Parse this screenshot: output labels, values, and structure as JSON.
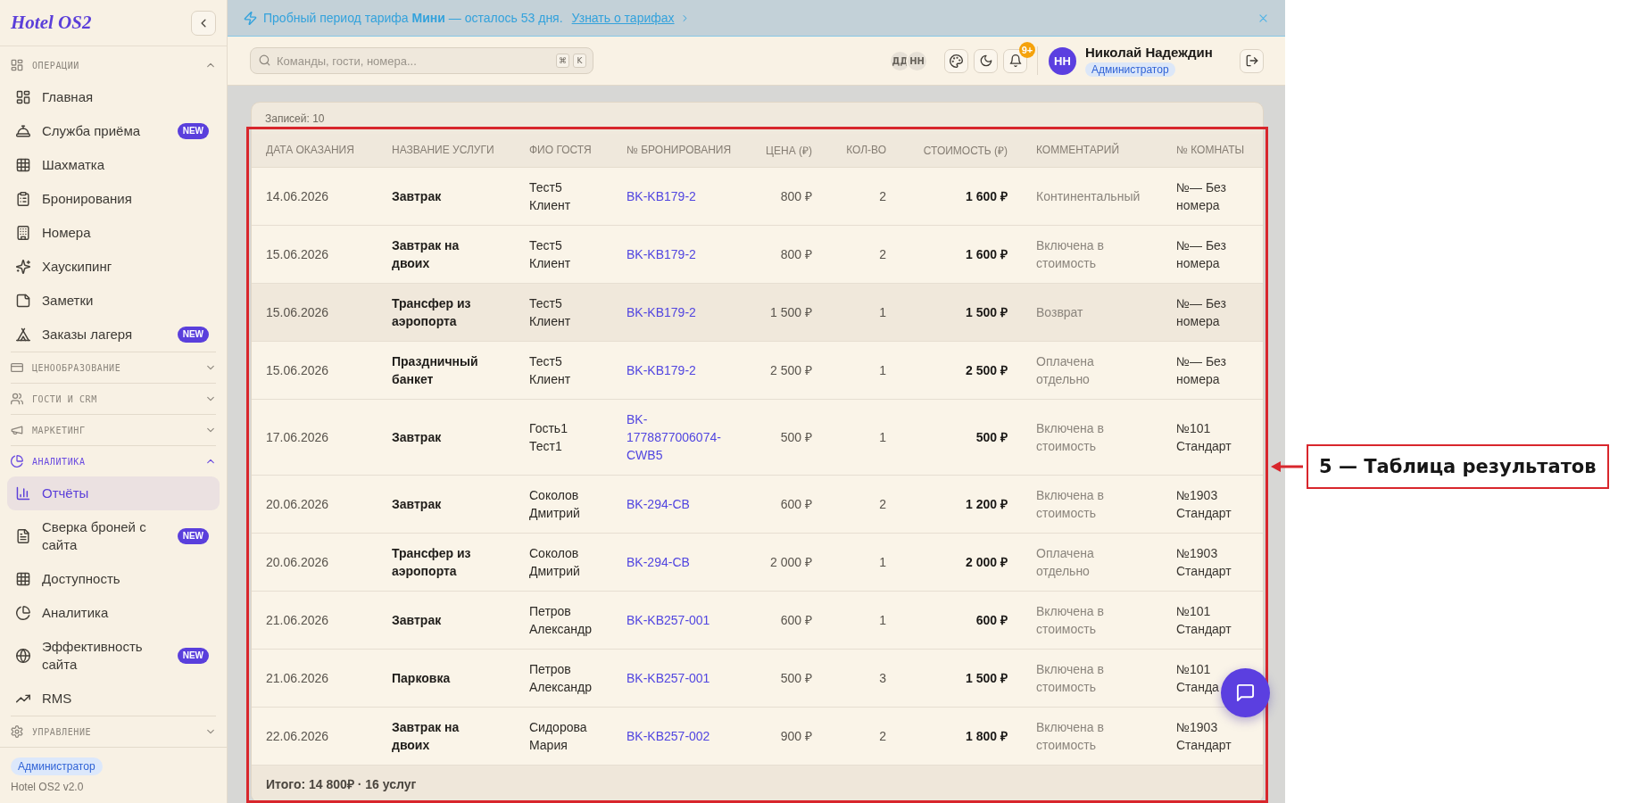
{
  "banner": {
    "message": "Пробный период тарифа **Мини** — осталось 53 дня.",
    "link": "Узнать о тарифах"
  },
  "sidebar": {
    "logo": "Hotel OS2",
    "sections": [
      {
        "title": "ОПЕРАЦИИ",
        "expanded": true,
        "items": [
          {
            "label": "Главная",
            "selected": false
          },
          {
            "label": "Служба приёма",
            "badge": "NEW",
            "selected": false
          },
          {
            "label": "Шахматка",
            "selected": false
          },
          {
            "label": "Бронирования",
            "selected": false
          },
          {
            "label": "Номера",
            "selected": false
          },
          {
            "label": "Хаускипинг",
            "selected": false
          },
          {
            "label": "Заметки",
            "selected": false
          },
          {
            "label": "Заказы лагеря",
            "badge": "NEW",
            "selected": false
          }
        ]
      },
      {
        "title": "ЦЕНООБРАЗОВАНИЕ",
        "expanded": false
      },
      {
        "title": "ГОСТИ И CRM",
        "expanded": false
      },
      {
        "title": "МАРКЕТИНГ",
        "expanded": false
      },
      {
        "title": "АНАЛИТИКА",
        "expanded": true,
        "items": [
          {
            "label": "Отчёты",
            "selected": true
          },
          {
            "label": "Сверка броней с сайта",
            "badge": "NEW",
            "selected": false
          },
          {
            "label": "Доступность",
            "selected": false
          },
          {
            "label": "Аналитика",
            "selected": false
          },
          {
            "label": "Эффективность сайта",
            "badge": "NEW",
            "selected": false
          },
          {
            "label": "RMS",
            "selected": false
          }
        ]
      },
      {
        "title": "УПРАВЛЕНИЕ",
        "expanded": false
      }
    ],
    "footer": {
      "role": "Администратор",
      "version": "Hotel OS2 v2.0"
    }
  },
  "header": {
    "search": {
      "placeholder": "Команды, гости, номера...",
      "shortcut": [
        "⌘",
        "K"
      ]
    },
    "presence": [
      "ДД",
      "НН"
    ],
    "notifications": {
      "count": "9+"
    },
    "user": {
      "initials": "НН",
      "name": "Николай Надеждин",
      "role": "Администратор"
    }
  },
  "report": {
    "records": "Записей: 10",
    "table": {
      "columns": [
        "ДАТА ОКАЗАНИЯ",
        "НАЗВАНИЕ УСЛУГИ",
        "ФИО ГОСТЯ",
        "№ БРОНИРОВАНИЯ",
        "ЦЕНА (₽)",
        "КОЛ-ВО",
        "СТОИМОСТЬ (₽)",
        "КОММЕНТАРИЙ",
        "№ КОМНАТЫ"
      ],
      "rows": [
        {
          "date": "14.06.2026",
          "service": "Завтрак",
          "guest": "Тест5 Клиент",
          "booking": "BK-KB179-2",
          "price": "800 ₽",
          "quantity": "2",
          "cost": "1 600 ₽",
          "comment": "Континентальный",
          "room": "№— Без номера",
          "highlighted": false
        },
        {
          "date": "15.06.2026",
          "service": "Завтрак на двоих",
          "guest": "Тест5 Клиент",
          "booking": "BK-KB179-2",
          "price": "800 ₽",
          "quantity": "2",
          "cost": "1 600 ₽",
          "comment": "Включена в стоимость",
          "room": "№— Без номера",
          "highlighted": false
        },
        {
          "date": "15.06.2026",
          "service": "Трансфер из аэропорта",
          "guest": "Тест5 Клиент",
          "booking": "BK-KB179-2",
          "price": "1 500 ₽",
          "quantity": "1",
          "cost": "1 500 ₽",
          "comment": "Возврат",
          "room": "№— Без номера",
          "highlighted": true
        },
        {
          "date": "15.06.2026",
          "service": "Праздничный банкет",
          "guest": "Тест5 Клиент",
          "booking": "BK-KB179-2",
          "price": "2 500 ₽",
          "quantity": "1",
          "cost": "2 500 ₽",
          "comment": "Оплачена отдельно",
          "room": "№— Без номера",
          "highlighted": false
        },
        {
          "date": "17.06.2026",
          "service": "Завтрак",
          "guest": "Гость1 Тест1",
          "booking": "BK-1778877006074-CWB5",
          "price": "500 ₽",
          "quantity": "1",
          "cost": "500 ₽",
          "comment": "Включена в стоимость",
          "room": "№101 Стандарт",
          "highlighted": false
        },
        {
          "date": "20.06.2026",
          "service": "Завтрак",
          "guest": "Соколов Дмитрий",
          "booking": "BK-294-CB",
          "price": "600 ₽",
          "quantity": "2",
          "cost": "1 200 ₽",
          "comment": "Включена в стоимость",
          "room": "№1903 Стандарт",
          "highlighted": false
        },
        {
          "date": "20.06.2026",
          "service": "Трансфер из аэропорта",
          "guest": "Соколов Дмитрий",
          "booking": "BK-294-CB",
          "price": "2 000 ₽",
          "quantity": "1",
          "cost": "2 000 ₽",
          "comment": "Оплачена отдельно",
          "room": "№1903 Стандарт",
          "highlighted": false
        },
        {
          "date": "21.06.2026",
          "service": "Завтрак",
          "guest": "Петров Александр",
          "booking": "BK-KB257-001",
          "price": "600 ₽",
          "quantity": "1",
          "cost": "600 ₽",
          "comment": "Включена в стоимость",
          "room": "№101 Стандарт",
          "highlighted": false
        },
        {
          "date": "21.06.2026",
          "service": "Парковка",
          "guest": "Петров Александр",
          "booking": "BK-KB257-001",
          "price": "500 ₽",
          "quantity": "3",
          "cost": "1 500 ₽",
          "comment": "Включена в стоимость",
          "room": "№101 Станда",
          "highlighted": false
        },
        {
          "date": "22.06.2026",
          "service": "Завтрак на двоих",
          "guest": "Сидорова Мария",
          "booking": "BK-KB257-002",
          "price": "900 ₽",
          "quantity": "2",
          "cost": "1 800 ₽",
          "comment": "Включена в стоимость",
          "room": "№1903 Стандарт",
          "highlighted": false
        }
      ],
      "total": "Итого: 14 800₽ · 16 услуг"
    }
  },
  "annotation": {
    "label": "5 — Таблица результатов"
  }
}
